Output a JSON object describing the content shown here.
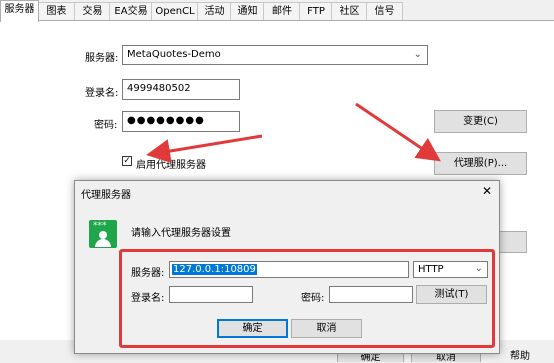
{
  "tabs": [
    "服务器",
    "图表",
    "交易",
    "EA交易",
    "OpenCL",
    "活动",
    "通知",
    "邮件",
    "FTP",
    "社区",
    "信号"
  ],
  "active_tab": "服务器",
  "form": {
    "server_label": "服务器:",
    "server_value": "MetaQuotes-Demo",
    "login_label": "登录名:",
    "login_value": "4999480502",
    "password_label": "密码:",
    "password_value": "●●●●●●●●",
    "change_button": "变更(C)",
    "proxy_checkbox_label": "启用代理服务器",
    "proxy_checked": true,
    "proxy_button": "代理服(P)..."
  },
  "footer": {
    "ok_button": "确定",
    "cancel_button": "取消",
    "help_button": "帮助"
  },
  "proxy_dialog": {
    "title": "代理服务器",
    "close_glyph": "✕",
    "prompt": "请输入代理服务器设置",
    "icon_text": "***",
    "server_label": "服务器:",
    "server_value": "127.0.0.1:10809",
    "type_value": "HTTP",
    "login_label": "登录名:",
    "login_value": "",
    "password_label": "密码:",
    "password_value": "",
    "test_button": "测试(T)",
    "ok_button": "确定",
    "cancel_button": "取消"
  },
  "colors": {
    "annotation_red": "#e03a3a",
    "selection_blue": "#0078d7",
    "icon_green": "#1fa64a"
  }
}
